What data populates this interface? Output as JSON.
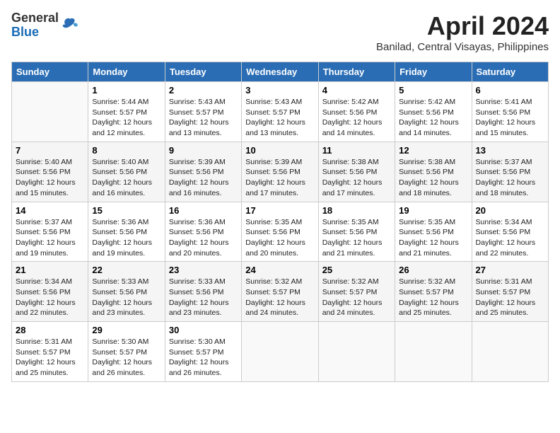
{
  "header": {
    "logo_general": "General",
    "logo_blue": "Blue",
    "month_title": "April 2024",
    "subtitle": "Banilad, Central Visayas, Philippines"
  },
  "weekdays": [
    "Sunday",
    "Monday",
    "Tuesday",
    "Wednesday",
    "Thursday",
    "Friday",
    "Saturday"
  ],
  "weeks": [
    [
      {
        "day": "",
        "sunrise": "",
        "sunset": "",
        "daylight": ""
      },
      {
        "day": "1",
        "sunrise": "5:44 AM",
        "sunset": "5:57 PM",
        "daylight": "12 hours and 12 minutes."
      },
      {
        "day": "2",
        "sunrise": "5:43 AM",
        "sunset": "5:57 PM",
        "daylight": "12 hours and 13 minutes."
      },
      {
        "day": "3",
        "sunrise": "5:43 AM",
        "sunset": "5:57 PM",
        "daylight": "12 hours and 13 minutes."
      },
      {
        "day": "4",
        "sunrise": "5:42 AM",
        "sunset": "5:56 PM",
        "daylight": "12 hours and 14 minutes."
      },
      {
        "day": "5",
        "sunrise": "5:42 AM",
        "sunset": "5:56 PM",
        "daylight": "12 hours and 14 minutes."
      },
      {
        "day": "6",
        "sunrise": "5:41 AM",
        "sunset": "5:56 PM",
        "daylight": "12 hours and 15 minutes."
      }
    ],
    [
      {
        "day": "7",
        "sunrise": "5:40 AM",
        "sunset": "5:56 PM",
        "daylight": "12 hours and 15 minutes."
      },
      {
        "day": "8",
        "sunrise": "5:40 AM",
        "sunset": "5:56 PM",
        "daylight": "12 hours and 16 minutes."
      },
      {
        "day": "9",
        "sunrise": "5:39 AM",
        "sunset": "5:56 PM",
        "daylight": "12 hours and 16 minutes."
      },
      {
        "day": "10",
        "sunrise": "5:39 AM",
        "sunset": "5:56 PM",
        "daylight": "12 hours and 17 minutes."
      },
      {
        "day": "11",
        "sunrise": "5:38 AM",
        "sunset": "5:56 PM",
        "daylight": "12 hours and 17 minutes."
      },
      {
        "day": "12",
        "sunrise": "5:38 AM",
        "sunset": "5:56 PM",
        "daylight": "12 hours and 18 minutes."
      },
      {
        "day": "13",
        "sunrise": "5:37 AM",
        "sunset": "5:56 PM",
        "daylight": "12 hours and 18 minutes."
      }
    ],
    [
      {
        "day": "14",
        "sunrise": "5:37 AM",
        "sunset": "5:56 PM",
        "daylight": "12 hours and 19 minutes."
      },
      {
        "day": "15",
        "sunrise": "5:36 AM",
        "sunset": "5:56 PM",
        "daylight": "12 hours and 19 minutes."
      },
      {
        "day": "16",
        "sunrise": "5:36 AM",
        "sunset": "5:56 PM",
        "daylight": "12 hours and 20 minutes."
      },
      {
        "day": "17",
        "sunrise": "5:35 AM",
        "sunset": "5:56 PM",
        "daylight": "12 hours and 20 minutes."
      },
      {
        "day": "18",
        "sunrise": "5:35 AM",
        "sunset": "5:56 PM",
        "daylight": "12 hours and 21 minutes."
      },
      {
        "day": "19",
        "sunrise": "5:35 AM",
        "sunset": "5:56 PM",
        "daylight": "12 hours and 21 minutes."
      },
      {
        "day": "20",
        "sunrise": "5:34 AM",
        "sunset": "5:56 PM",
        "daylight": "12 hours and 22 minutes."
      }
    ],
    [
      {
        "day": "21",
        "sunrise": "5:34 AM",
        "sunset": "5:56 PM",
        "daylight": "12 hours and 22 minutes."
      },
      {
        "day": "22",
        "sunrise": "5:33 AM",
        "sunset": "5:56 PM",
        "daylight": "12 hours and 23 minutes."
      },
      {
        "day": "23",
        "sunrise": "5:33 AM",
        "sunset": "5:56 PM",
        "daylight": "12 hours and 23 minutes."
      },
      {
        "day": "24",
        "sunrise": "5:32 AM",
        "sunset": "5:57 PM",
        "daylight": "12 hours and 24 minutes."
      },
      {
        "day": "25",
        "sunrise": "5:32 AM",
        "sunset": "5:57 PM",
        "daylight": "12 hours and 24 minutes."
      },
      {
        "day": "26",
        "sunrise": "5:32 AM",
        "sunset": "5:57 PM",
        "daylight": "12 hours and 25 minutes."
      },
      {
        "day": "27",
        "sunrise": "5:31 AM",
        "sunset": "5:57 PM",
        "daylight": "12 hours and 25 minutes."
      }
    ],
    [
      {
        "day": "28",
        "sunrise": "5:31 AM",
        "sunset": "5:57 PM",
        "daylight": "12 hours and 25 minutes."
      },
      {
        "day": "29",
        "sunrise": "5:30 AM",
        "sunset": "5:57 PM",
        "daylight": "12 hours and 26 minutes."
      },
      {
        "day": "30",
        "sunrise": "5:30 AM",
        "sunset": "5:57 PM",
        "daylight": "12 hours and 26 minutes."
      },
      {
        "day": "",
        "sunrise": "",
        "sunset": "",
        "daylight": ""
      },
      {
        "day": "",
        "sunrise": "",
        "sunset": "",
        "daylight": ""
      },
      {
        "day": "",
        "sunrise": "",
        "sunset": "",
        "daylight": ""
      },
      {
        "day": "",
        "sunrise": "",
        "sunset": "",
        "daylight": ""
      }
    ]
  ]
}
